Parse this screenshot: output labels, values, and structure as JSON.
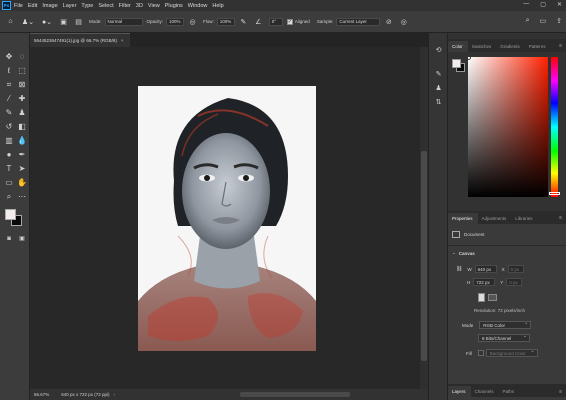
{
  "menubar": {
    "logo": "Ps",
    "items": [
      "File",
      "Edit",
      "Image",
      "Layer",
      "Type",
      "Select",
      "Filter",
      "3D",
      "View",
      "Plugins",
      "Window",
      "Help"
    ],
    "window_controls": [
      "—",
      "▢",
      "✕"
    ]
  },
  "options_bar": {
    "mode_label": "Mode:",
    "mode_value": "Normal",
    "opacity_label": "Opacity:",
    "opacity_value": "100%",
    "flow_label": "Flow:",
    "flow_value": "100%",
    "angle_value": "0°",
    "aligned_label": "Aligned",
    "aligned_checked": true,
    "sample_label": "Sample:",
    "sample_value": "Current Layer"
  },
  "document": {
    "tab_title": "5644523647491(1).jpg @ 66.7% (RGB/8)",
    "zoom": "66.67%",
    "size": "640 px x 722 px (72 ppi)"
  },
  "color_panel": {
    "tabs": [
      "Color",
      "Swatches",
      "Gradients",
      "Patterns"
    ],
    "active_tab": "Color",
    "foreground": "#f2ecea",
    "background": "#0a0a0a",
    "picker_hue": "#ff2000"
  },
  "properties_panel": {
    "tabs": [
      "Properties",
      "Adjustments",
      "Libraries"
    ],
    "active_tab": "Properties",
    "doc_label": "Document",
    "section": "Canvas",
    "w_label": "W",
    "w_value": "640 px",
    "x_label": "X",
    "x_value": "0 px",
    "h_label": "H",
    "h_value": "722 px",
    "y_label": "Y",
    "y_value": "0 px",
    "resolution": "Resolution: 72 pixels/inch",
    "mode_label": "Mode",
    "mode_value": "RGB Color",
    "depth_value": "8 Bits/Channel",
    "fill_label": "Fill",
    "fill_value": "Background Color"
  },
  "layers_panel": {
    "tabs": [
      "Layers",
      "Channels",
      "Paths"
    ],
    "active_tab": "Layers"
  }
}
